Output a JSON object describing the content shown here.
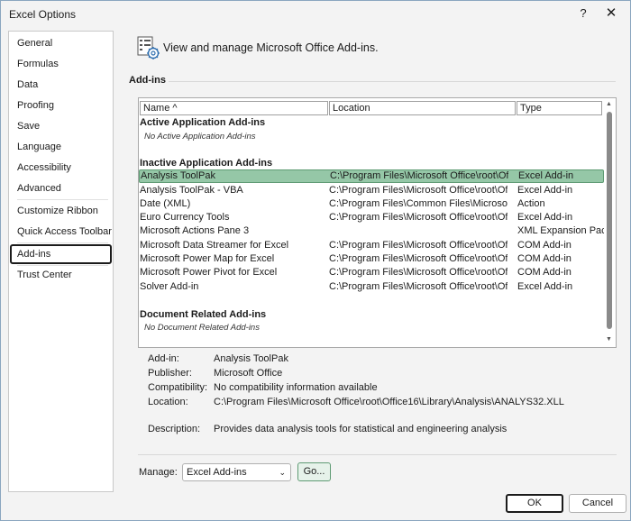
{
  "window": {
    "title": "Excel Options",
    "help_glyph": "?",
    "close_glyph": "✕"
  },
  "nav": {
    "items": [
      {
        "label": "General"
      },
      {
        "label": "Formulas"
      },
      {
        "label": "Data"
      },
      {
        "label": "Proofing"
      },
      {
        "label": "Save"
      },
      {
        "label": "Language"
      },
      {
        "label": "Accessibility"
      },
      {
        "label": "Advanced"
      },
      {
        "label": "Customize Ribbon"
      },
      {
        "label": "Quick Access Toolbar"
      },
      {
        "label": "Add-ins"
      },
      {
        "label": "Trust Center"
      }
    ],
    "selected": "Add-ins"
  },
  "main": {
    "header": "View and manage Microsoft Office Add-ins.",
    "section_title": "Add-ins",
    "columns": {
      "name": "Name ^",
      "location": "Location",
      "type": "Type"
    },
    "groups": {
      "active": {
        "title": "Active Application Add-ins",
        "empty": "No Active Application Add-ins"
      },
      "inactive": {
        "title": "Inactive Application Add-ins"
      },
      "document": {
        "title": "Document Related Add-ins",
        "empty": "No Document Related Add-ins"
      }
    },
    "rows": [
      {
        "name": "Analysis ToolPak",
        "location": "C:\\Program Files\\Microsoft Office\\root\\Offi",
        "type": "Excel Add-in"
      },
      {
        "name": "Analysis ToolPak - VBA",
        "location": "C:\\Program Files\\Microsoft Office\\root\\Offi",
        "type": "Excel Add-in"
      },
      {
        "name": "Date (XML)",
        "location": "C:\\Program Files\\Common Files\\Microsoft",
        "type": "Action"
      },
      {
        "name": "Euro Currency Tools",
        "location": "C:\\Program Files\\Microsoft Office\\root\\Offi",
        "type": "Excel Add-in"
      },
      {
        "name": "Microsoft Actions Pane 3",
        "location": "",
        "type": "XML Expansion Pack"
      },
      {
        "name": "Microsoft Data Streamer for Excel",
        "location": "C:\\Program Files\\Microsoft Office\\root\\Offi",
        "type": "COM Add-in"
      },
      {
        "name": "Microsoft Power Map for Excel",
        "location": "C:\\Program Files\\Microsoft Office\\root\\Offi",
        "type": "COM Add-in"
      },
      {
        "name": "Microsoft Power Pivot for Excel",
        "location": "C:\\Program Files\\Microsoft Office\\root\\Offi",
        "type": "COM Add-in"
      },
      {
        "name": "Solver Add-in",
        "location": "C:\\Program Files\\Microsoft Office\\root\\Offi",
        "type": "Excel Add-in"
      }
    ],
    "selected_row": "Analysis ToolPak",
    "details": {
      "addin_label": "Add-in:",
      "addin_value": "Analysis ToolPak",
      "publisher_label": "Publisher:",
      "publisher_value": "Microsoft Office",
      "compat_label": "Compatibility:",
      "compat_value": "No compatibility information available",
      "location_label": "Location:",
      "location_value": "C:\\Program Files\\Microsoft Office\\root\\Office16\\Library\\Analysis\\ANALYS32.XLL",
      "description_label": "Description:",
      "description_value": "Provides data analysis tools for statistical and engineering analysis"
    },
    "manage": {
      "label": "Manage:",
      "selected": "Excel Add-ins",
      "go_label": "Go..."
    }
  },
  "buttons": {
    "ok": "OK",
    "cancel": "Cancel"
  },
  "colors": {
    "selection": "#95c7a7",
    "selection_border": "#5f9b74"
  },
  "icons": {
    "header": "addins-gear-icon"
  }
}
